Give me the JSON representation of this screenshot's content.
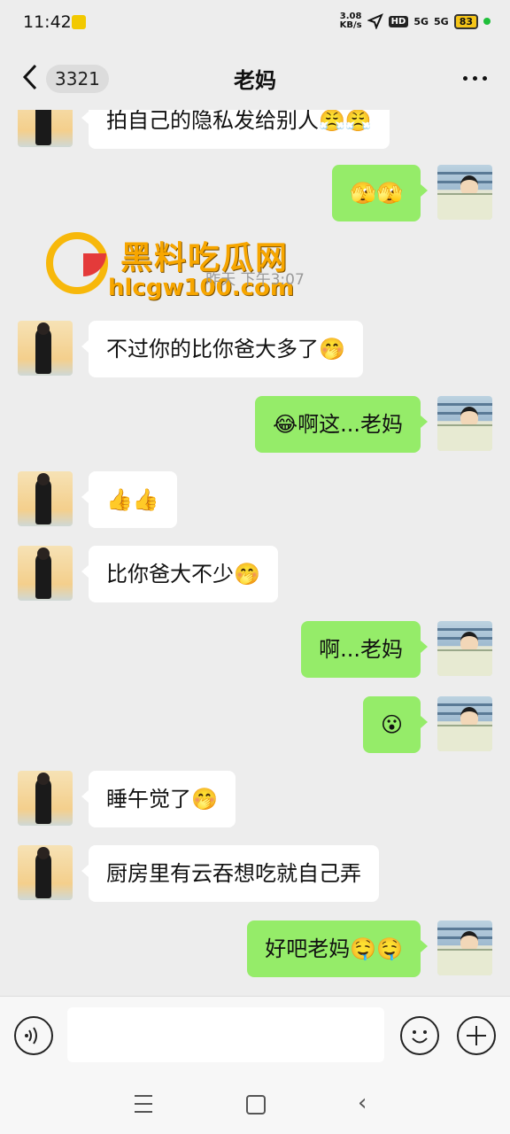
{
  "status_bar": {
    "time": "11:42",
    "net_speed": "3.08",
    "net_unit": "KB/s",
    "hd": "HD",
    "sig1": "5G",
    "sig2": "5G",
    "battery": "83"
  },
  "header": {
    "back_icon": "chevron-left-icon",
    "unread_count": "3321",
    "title": "老妈",
    "more_icon": "more-dots-icon"
  },
  "watermark": {
    "name": "黑料吃瓜网",
    "url": "hlcgw100.com"
  },
  "timestamp": "昨天 下午3:07",
  "messages": [
    {
      "side": "left",
      "text": "拍自己的隐私发给别人😤😤"
    },
    {
      "side": "right",
      "text": "🫣🫣"
    },
    {
      "side": "left",
      "text": "不过你的比你爸大多了🤭"
    },
    {
      "side": "right",
      "text": "😂啊这...老妈"
    },
    {
      "side": "left",
      "text": "👍👍"
    },
    {
      "side": "left",
      "text": "比你爸大不少🤭"
    },
    {
      "side": "right",
      "text": "啊...老妈"
    },
    {
      "side": "right",
      "text": "😮"
    },
    {
      "side": "left",
      "text": "睡午觉了🤭"
    },
    {
      "side": "left",
      "text": "厨房里有云吞想吃就自己弄"
    },
    {
      "side": "right",
      "text": "好吧老妈🤤🤤"
    }
  ],
  "input_bar": {
    "voice_icon": "voice-icon",
    "emoji_icon": "emoji-icon",
    "plus_icon": "plus-icon",
    "value": ""
  },
  "system_nav": {
    "menu_icon": "menu-icon",
    "home_icon": "home-icon",
    "back_icon": "back-icon",
    "back_glyph": "‹"
  }
}
